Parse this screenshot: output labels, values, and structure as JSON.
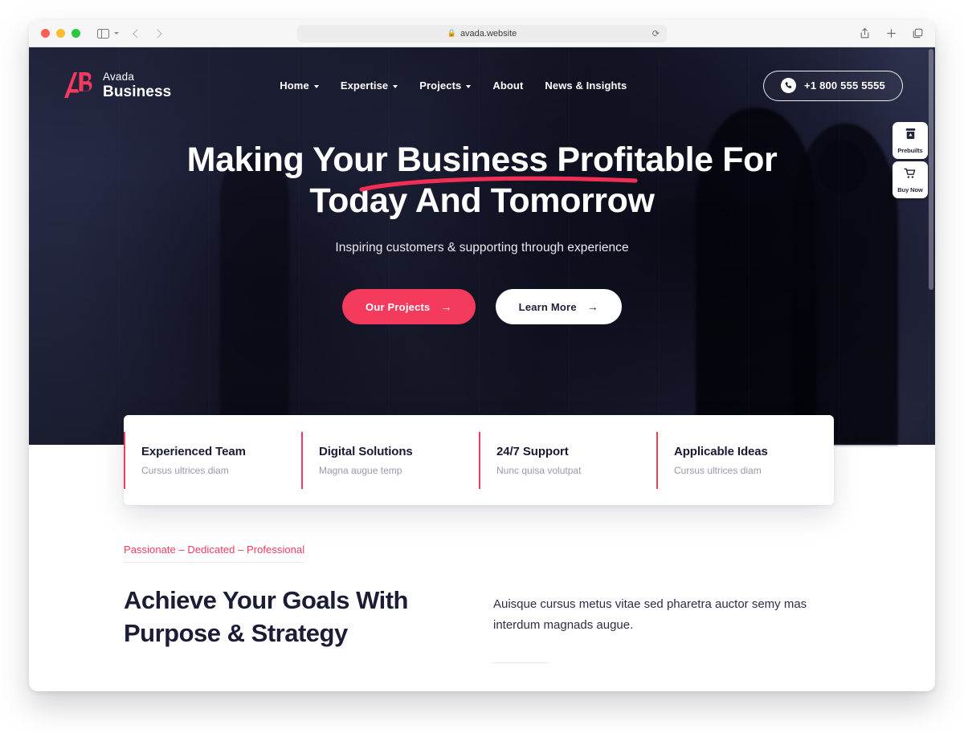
{
  "browser": {
    "url": "avada.website",
    "lock_icon": "lock-icon",
    "reload_icon": "reload-icon",
    "sidebar_icon": "sidebar-toggle-icon",
    "back_icon": "back-chevron-icon",
    "forward_icon": "forward-chevron-icon",
    "share_icon": "share-icon",
    "new_tab_icon": "plus-icon",
    "tabs_icon": "tab-overview-icon",
    "traffic_lights": [
      "close",
      "minimize",
      "zoom"
    ]
  },
  "site": {
    "logo": {
      "mark": "ab-monogram-icon",
      "line1": "Avada",
      "line2": "Business"
    },
    "nav": [
      {
        "label": "Home",
        "has_dropdown": true
      },
      {
        "label": "Expertise",
        "has_dropdown": true
      },
      {
        "label": "Projects",
        "has_dropdown": true
      },
      {
        "label": "About",
        "has_dropdown": false
      },
      {
        "label": "News & Insights",
        "has_dropdown": false
      }
    ],
    "phone_button": {
      "label": "+1 800 555 5555",
      "icon": "phone-icon"
    }
  },
  "hero": {
    "headline_line1": "Making Your Business Profitable For",
    "headline_line2": "Today And Tomorrow",
    "subheadline": "Inspiring customers & supporting through experience",
    "buttons": [
      {
        "label": "Our Projects",
        "arrow": "→",
        "style": "primary"
      },
      {
        "label": "Learn More",
        "arrow": "→",
        "style": "light"
      }
    ]
  },
  "side_widget": [
    {
      "label": "Prebuilts",
      "icon": "prebuilts-box-icon"
    },
    {
      "label": "Buy Now",
      "icon": "shopping-cart-icon"
    }
  ],
  "features": [
    {
      "title": "Experienced Team",
      "subtitle": "Cursus ultrices diam"
    },
    {
      "title": "Digital Solutions",
      "subtitle": "Magna augue temp"
    },
    {
      "title": "24/7 Support",
      "subtitle": "Nunc quisa volutpat"
    },
    {
      "title": "Applicable Ideas",
      "subtitle": "Cursus ultrices diam"
    }
  ],
  "section": {
    "eyebrow": "Passionate – Dedicated – Professional",
    "title_line1": "Achieve Your Goals With",
    "title_line2": "Purpose & Strategy",
    "paragraph": "Auisque cursus metus vitae sed pharetra auctor semy mas interdum magnads augue."
  },
  "colors": {
    "accent": "#f43b5e",
    "dark_navy": "#22243c",
    "text_dark": "#1b1d36",
    "muted": "#9799ad"
  }
}
